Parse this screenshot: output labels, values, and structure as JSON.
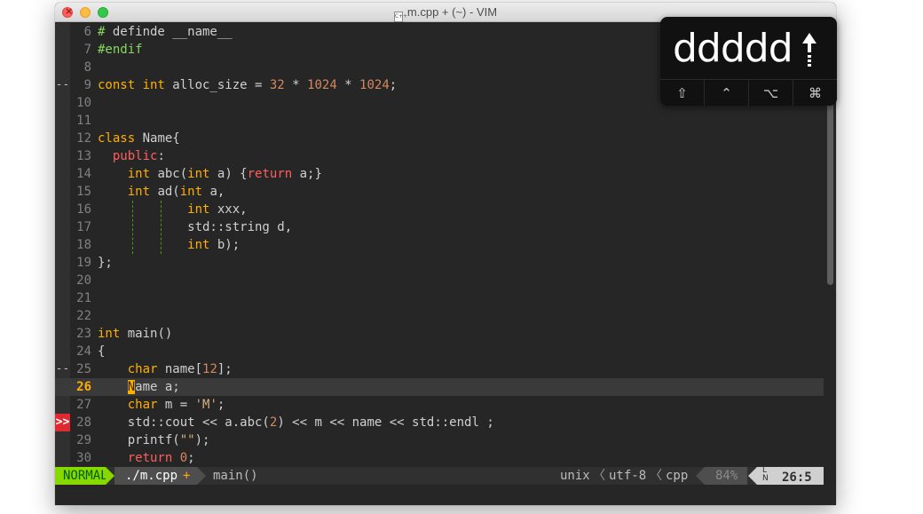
{
  "window": {
    "title": "m.cpp + (~) - VIM",
    "file_icon_label": "C++"
  },
  "lines": [
    {
      "num": "6",
      "sign": "",
      "tokens": [
        [
          "pp",
          "# "
        ],
        [
          "pn",
          "definde __name__"
        ]
      ]
    },
    {
      "num": "7",
      "sign": "",
      "tokens": [
        [
          "pp",
          "#endif"
        ]
      ]
    },
    {
      "num": "8",
      "sign": "",
      "tokens": []
    },
    {
      "num": "9",
      "sign": "--",
      "tokens": [
        [
          "ty",
          "const int"
        ],
        [
          "pn",
          " alloc_size = "
        ],
        [
          "num",
          "32"
        ],
        [
          "pn",
          " * "
        ],
        [
          "num",
          "1024"
        ],
        [
          "pn",
          " * "
        ],
        [
          "num",
          "1024"
        ],
        [
          "pn",
          ";"
        ]
      ]
    },
    {
      "num": "10",
      "sign": "",
      "tokens": []
    },
    {
      "num": "11",
      "sign": "",
      "tokens": []
    },
    {
      "num": "12",
      "sign": "",
      "tokens": [
        [
          "ty",
          "class"
        ],
        [
          "pn",
          " Name{"
        ]
      ]
    },
    {
      "num": "13",
      "sign": "",
      "tokens": [
        [
          "pn",
          "  "
        ],
        [
          "kw",
          "public"
        ],
        [
          "pn",
          ":"
        ]
      ]
    },
    {
      "num": "14",
      "sign": "",
      "tokens": [
        [
          "pn",
          "    "
        ],
        [
          "ty",
          "int"
        ],
        [
          "pn",
          " abc("
        ],
        [
          "ty",
          "int"
        ],
        [
          "pn",
          " a) {"
        ],
        [
          "kw",
          "return"
        ],
        [
          "pn",
          " a;}"
        ]
      ]
    },
    {
      "num": "15",
      "sign": "",
      "tokens": [
        [
          "pn",
          "    "
        ],
        [
          "ty",
          "int"
        ],
        [
          "pn",
          " ad("
        ],
        [
          "ty",
          "int"
        ],
        [
          "pn",
          " a,"
        ]
      ]
    },
    {
      "num": "16",
      "sign": "",
      "tokens": [
        [
          "pn",
          "            "
        ],
        [
          "ty",
          "int"
        ],
        [
          "pn",
          " xxx,"
        ]
      ]
    },
    {
      "num": "17",
      "sign": "",
      "tokens": [
        [
          "pn",
          "            std::string d,"
        ]
      ]
    },
    {
      "num": "18",
      "sign": "",
      "tokens": [
        [
          "pn",
          "            "
        ],
        [
          "ty",
          "int"
        ],
        [
          "pn",
          " b);"
        ]
      ]
    },
    {
      "num": "19",
      "sign": "",
      "tokens": [
        [
          "pn",
          "};"
        ]
      ]
    },
    {
      "num": "20",
      "sign": "",
      "tokens": []
    },
    {
      "num": "21",
      "sign": "",
      "tokens": []
    },
    {
      "num": "22",
      "sign": "",
      "tokens": []
    },
    {
      "num": "23",
      "sign": "",
      "tokens": [
        [
          "ty",
          "int"
        ],
        [
          "pn",
          " main()"
        ]
      ]
    },
    {
      "num": "24",
      "sign": "",
      "tokens": [
        [
          "pn",
          "{"
        ]
      ]
    },
    {
      "num": "25",
      "sign": "--",
      "tokens": [
        [
          "pn",
          "    "
        ],
        [
          "ty",
          "char"
        ],
        [
          "pn",
          " name["
        ],
        [
          "num",
          "12"
        ],
        [
          "pn",
          "];"
        ]
      ]
    },
    {
      "num": "26",
      "sign": "",
      "current": true,
      "tokens": [
        [
          "pn",
          "    "
        ],
        [
          "cursor",
          "N"
        ],
        [
          "pn",
          "ame a;"
        ]
      ]
    },
    {
      "num": "27",
      "sign": "",
      "tokens": [
        [
          "pn",
          "    "
        ],
        [
          "ty",
          "char"
        ],
        [
          "pn",
          " m = "
        ],
        [
          "str",
          "'M'"
        ],
        [
          "pn",
          ";"
        ]
      ]
    },
    {
      "num": "28",
      "sign": ">>",
      "error": true,
      "tokens": [
        [
          "pn",
          "    std::cout << a.abc("
        ],
        [
          "num",
          "2"
        ],
        [
          "pn",
          ") << m << name << std::endl ;"
        ]
      ]
    },
    {
      "num": "29",
      "sign": "",
      "tokens": [
        [
          "pn",
          "    printf("
        ],
        [
          "str",
          "\"\""
        ],
        [
          "pn",
          ");"
        ]
      ]
    },
    {
      "num": "30",
      "sign": "",
      "tokens": [
        [
          "pn",
          "    "
        ],
        [
          "kw",
          "return"
        ],
        [
          "pn",
          " "
        ],
        [
          "num",
          "0"
        ],
        [
          "pn",
          ";"
        ]
      ]
    }
  ],
  "statusbar": {
    "mode": "NORMAL",
    "file": "./m.cpp",
    "modified": "+",
    "function": "main()",
    "fileformat": "unix",
    "encoding": "utf-8",
    "filetype": "cpp",
    "separator": "〈",
    "percent": "84%",
    "ln_icon_top": "L",
    "ln_icon_bottom": "N",
    "position": "26:5"
  },
  "overlay": {
    "keys": "ddddd",
    "modifiers": [
      "⇧",
      "⌃",
      "⌥",
      "⌘"
    ]
  },
  "colors": {
    "background": "#262626",
    "keyword": "#ff5f5f",
    "type": "#ffaf00",
    "number": "#d7875f",
    "preproc": "#87d75f",
    "mode_normal": "#87d700",
    "error_sign": "#e02a31"
  }
}
